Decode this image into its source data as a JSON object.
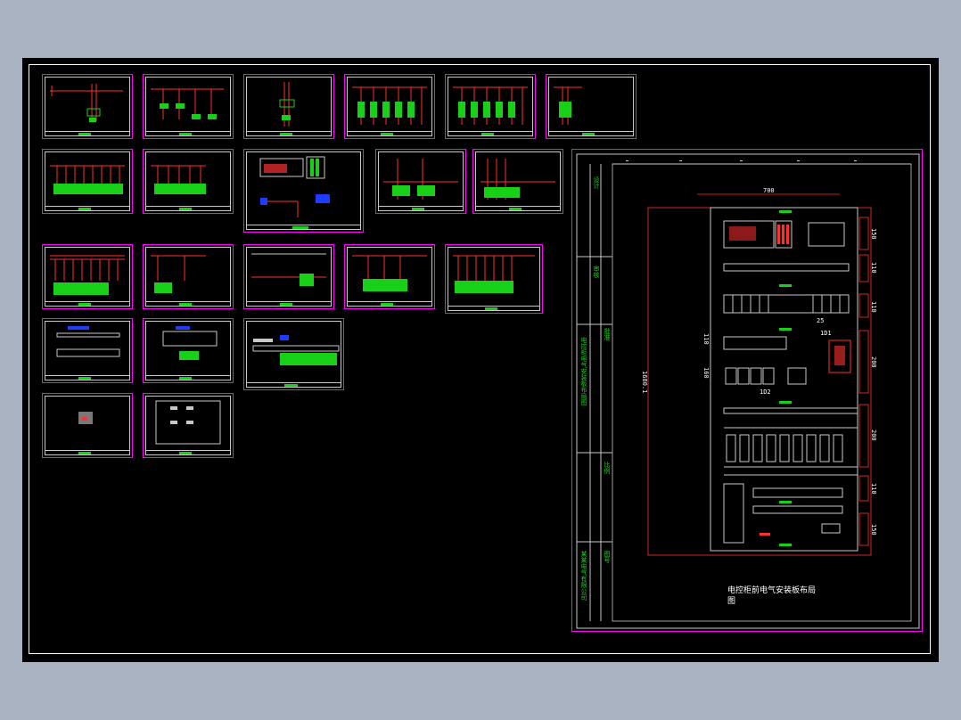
{
  "drawing": {
    "layout_title_line1": "电控柜前电气安装板布局",
    "layout_title_line2": "图",
    "dim_width": "700",
    "dim_height": "1680.1",
    "dim_small": "25",
    "dims_right": [
      "150",
      "110",
      "110",
      "200",
      "200",
      "110",
      "150"
    ],
    "dims_left": [
      "110",
      "160"
    ],
    "tag_labels": [
      "1D1",
      "1D2",
      "1D3",
      "1D4"
    ],
    "title_block_texts": [
      "某某电气有限公司",
      "电控柜电气安装板布局图",
      "设计",
      "审核",
      "批准",
      "比例",
      "图号"
    ]
  },
  "colors": {
    "background": "#000000",
    "sheet_frame": "#ff00ff",
    "annotation": "#19d019",
    "conductor": "#ff3030",
    "dimension": "#ffffff"
  }
}
